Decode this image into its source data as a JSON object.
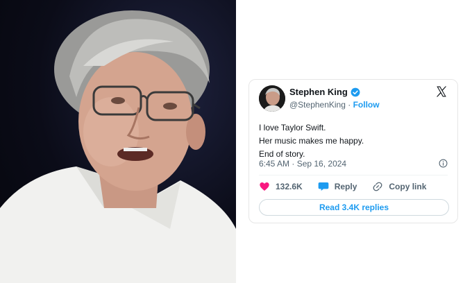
{
  "tweet": {
    "author_name": "Stephen King",
    "handle": "@StephenKing",
    "separator": "·",
    "follow_label": "Follow",
    "lines": [
      "I love Taylor Swift.",
      "Her music makes me happy.",
      "End of story."
    ],
    "timestamp": "6:45 AM · Sep 16, 2024",
    "likes": "132.6K",
    "reply_label": "Reply",
    "copy_link_label": "Copy link",
    "read_replies_label": "Read 3.4K replies"
  },
  "colors": {
    "accent": "#1d9bf0",
    "like": "#f91880",
    "text": "#0f1419",
    "muted": "#536471"
  },
  "icons": [
    "verified-badge-icon",
    "x-logo-icon",
    "info-icon",
    "heart-icon",
    "reply-bubble-icon",
    "link-icon"
  ]
}
